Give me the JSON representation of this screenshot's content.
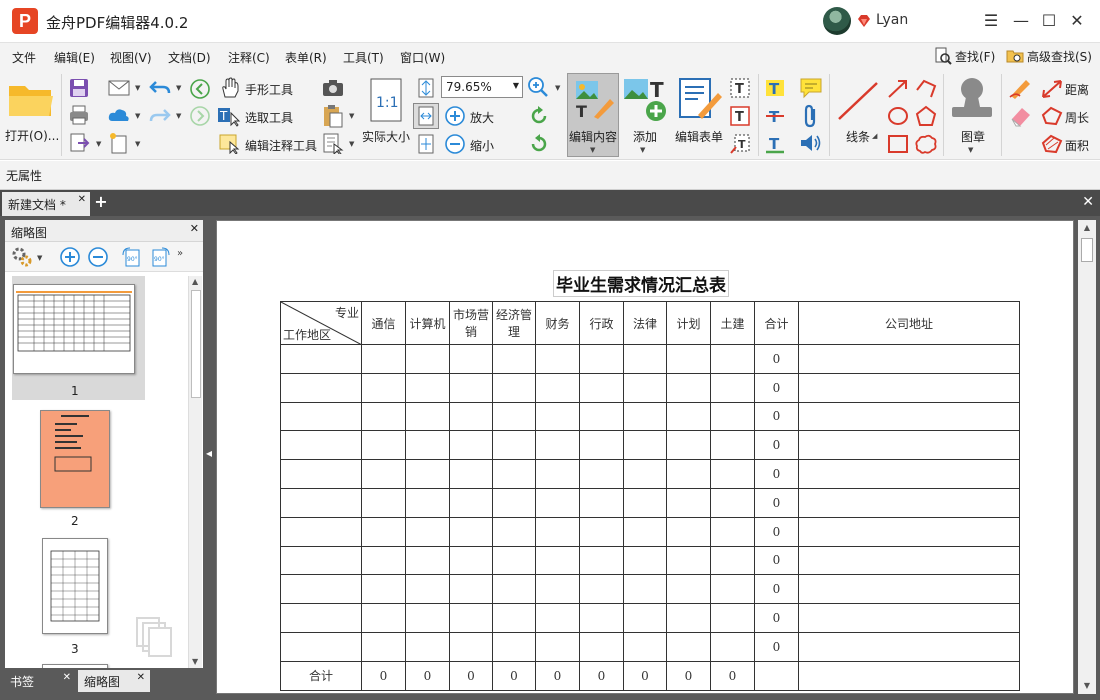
{
  "window": {
    "title": "金舟PDF编辑器4.0.2",
    "user": "Lyan"
  },
  "menu": {
    "items": [
      "文件",
      "编辑(E)",
      "视图(V)",
      "文档(D)",
      "注释(C)",
      "表单(R)",
      "工具(T)",
      "窗口(W)"
    ],
    "find": "查找(F)",
    "advanced_find": "高级查找(S)"
  },
  "toolbar": {
    "open": "打开(O)...",
    "hand_tool": "手形工具",
    "select_tool": "选取工具",
    "edit_annot_tool": "编辑注释工具",
    "actual_size": "实际大小",
    "zoom_value": "79.65%",
    "zoom_in": "放大",
    "zoom_out": "缩小",
    "edit_content": "编辑内容",
    "add": "添加",
    "edit_form": "编辑表单",
    "lines": "线条",
    "stamp": "图章",
    "distance": "距离",
    "perimeter": "周长",
    "area": "面积"
  },
  "properties": {
    "label": "无属性"
  },
  "tabs": {
    "doc_tab": "新建文档 *"
  },
  "left_panel": {
    "title": "缩略图",
    "pages": [
      "1",
      "2",
      "3"
    ],
    "bottom_tabs": [
      "书签",
      "缩略图"
    ]
  },
  "document": {
    "title": "毕业生需求情况汇总表",
    "corner_top": "专业",
    "corner_bottom": "工作地区",
    "columns": [
      "通信",
      "计算机",
      "市场营销",
      "经济管理",
      "财务",
      "行政",
      "法律",
      "计划",
      "土建",
      "合计",
      "公司地址"
    ],
    "row_total_value": "0",
    "total_label": "合计",
    "total_values": [
      "0",
      "0",
      "0",
      "0",
      "0",
      "0",
      "0",
      "0",
      "0"
    ]
  }
}
